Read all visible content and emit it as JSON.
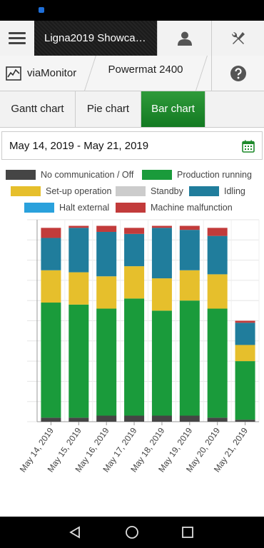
{
  "header": {
    "title": "Ligna2019 Showca…",
    "icons": {
      "menu": "hamburger-menu-icon",
      "user": "user-icon",
      "tools": "wrench-screwdriver-icon"
    }
  },
  "subheader": {
    "monitor_label": "viaMonitor",
    "machine_name": "Powermat 2400",
    "icons": {
      "monitor": "chart-monitor-icon",
      "help": "help-icon"
    }
  },
  "tabs": [
    {
      "label": "Gantt chart",
      "active": false
    },
    {
      "label": "Pie chart",
      "active": false
    },
    {
      "label": "Bar chart",
      "active": true
    }
  ],
  "date_range": {
    "value": "May 14, 2019 - May 21, 2019",
    "icon": "calendar-icon"
  },
  "colors": {
    "accent": "#1e8a2c"
  },
  "chart_data": {
    "type": "bar",
    "stacked": true,
    "categories": [
      "May 14, 2019",
      "May 15, 2019",
      "May 16, 2019",
      "May 17, 2019",
      "May 18, 2019",
      "May 19, 2019",
      "May 20, 2019",
      "May 21, 2019"
    ],
    "ylim": [
      0,
      1
    ],
    "grid": true,
    "legend_position": "top",
    "series": [
      {
        "name": "No communication / Off",
        "color": "#454545",
        "values": [
          0.02,
          0.02,
          0.03,
          0.03,
          0.03,
          0.03,
          0.02,
          0.01
        ]
      },
      {
        "name": "Production running",
        "color": "#1a9b3b",
        "values": [
          0.57,
          0.56,
          0.53,
          0.58,
          0.52,
          0.57,
          0.54,
          0.29
        ]
      },
      {
        "name": "Set-up operation",
        "color": "#e6bf2c",
        "values": [
          0.16,
          0.16,
          0.16,
          0.16,
          0.16,
          0.15,
          0.17,
          0.08
        ]
      },
      {
        "name": "Standby",
        "color": "#cccccc",
        "values": [
          0,
          0,
          0,
          0,
          0,
          0,
          0,
          0
        ]
      },
      {
        "name": "Idling",
        "color": "#207d9c",
        "values": [
          0.16,
          0.22,
          0.22,
          0.16,
          0.25,
          0.2,
          0.19,
          0.11
        ]
      },
      {
        "name": "Halt external",
        "color": "#2aa1dc",
        "values": [
          0,
          0,
          0,
          0,
          0,
          0,
          0,
          0
        ]
      },
      {
        "name": "Machine malfunction",
        "color": "#c23b3b",
        "values": [
          0.05,
          0.01,
          0.03,
          0.03,
          0.01,
          0.02,
          0.04,
          0.01
        ]
      }
    ]
  },
  "system_nav": {
    "back": "back-triangle-icon",
    "home": "home-circle-icon",
    "recents": "recents-square-icon"
  }
}
